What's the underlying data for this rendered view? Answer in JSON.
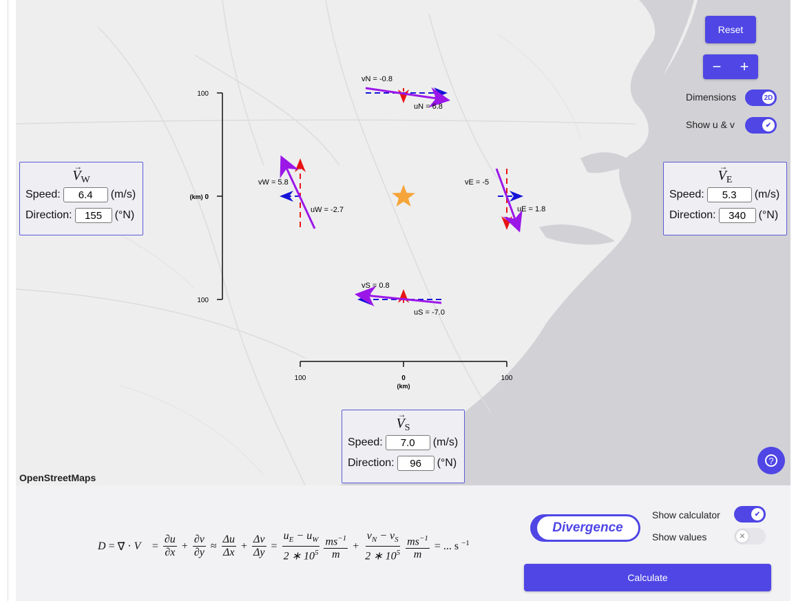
{
  "map": {
    "attribution": "OpenStreetMaps",
    "axis_left": {
      "top": "100",
      "mid": "0",
      "bottom": "100",
      "unit": "(km)"
    },
    "axis_bottom": {
      "left": "100",
      "mid": "0",
      "right": "100",
      "unit": "(km)"
    },
    "labels": {
      "vN": "vN = -0.8",
      "uN": "uN = 6.8",
      "vW": "vW = 5.8",
      "uW": "uW = -2.7",
      "vE": "vE = -5",
      "uE": "uE = 1.8",
      "vS": "vS = 0.8",
      "uS": "uS = -7.0"
    }
  },
  "controls": {
    "reset_label": "Reset",
    "zoom_out": "−",
    "zoom_in": "+",
    "dimensions_label": "Dimensions",
    "dimensions_value": "2D",
    "show_uv_label": "Show u & v"
  },
  "panels": {
    "west": {
      "title_letter": "V",
      "title_sub": "W",
      "speed_label": "Speed:",
      "speed": "6.4",
      "speed_unit": "(m/s)",
      "dir_label": "Direction:",
      "direction": "155",
      "dir_unit": "(°N)"
    },
    "east": {
      "title_letter": "V",
      "title_sub": "E",
      "speed_label": "Speed:",
      "speed": "5.3",
      "speed_unit": "(m/s)",
      "dir_label": "Direction:",
      "direction": "340",
      "dir_unit": "(°N)"
    },
    "south": {
      "title_letter": "V",
      "title_sub": "S",
      "speed_label": "Speed:",
      "speed": "7.0",
      "speed_unit": "(m/s)",
      "dir_label": "Direction:",
      "direction": "96",
      "dir_unit": "(°N)"
    }
  },
  "bottom": {
    "divergence_label": "Divergence",
    "show_calculator_label": "Show calculator",
    "show_values_label": "Show values",
    "calculate_label": "Calculate",
    "equation_end": "= ... s"
  },
  "colors": {
    "accent": "#4f46e5",
    "wind_vector": "#9b17e8",
    "u_component": "#1414d8",
    "v_component": "#e81414",
    "star": "#f5a53a"
  }
}
